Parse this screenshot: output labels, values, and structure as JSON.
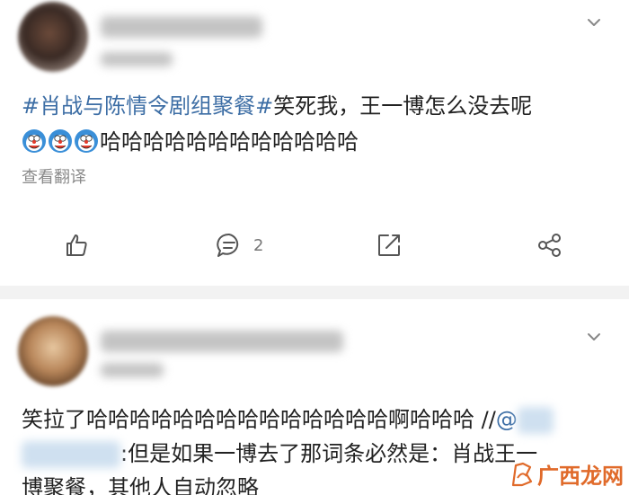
{
  "post1": {
    "hashtag": "#肖战与陈情令剧组聚餐#",
    "text_after_hashtag": "笑死我，王一博怎么没去呢",
    "laughter": "哈哈哈哈哈哈哈哈哈哈哈哈",
    "translate_label": "查看翻译",
    "comment_count": "2",
    "icons": [
      "thumbs-up-icon",
      "comment-icon",
      "repost-icon",
      "share-icon",
      "chevron-down-icon"
    ]
  },
  "post2": {
    "line1_text": "笑拉了哈哈哈哈哈哈哈哈哈哈哈哈哈哈啊哈哈哈 //",
    "line1_at": "@",
    "line2_text": ":但是如果一博去了那词条必然是：肖战王一",
    "line3_text": "博聚餐，其他人自动忽略"
  },
  "watermark": {
    "text": "广西龙网"
  },
  "colors": {
    "link": "#3d6ea5",
    "muted": "#8a8a8a",
    "separator": "#f2f2f2",
    "watermark": "#e06a2a"
  }
}
